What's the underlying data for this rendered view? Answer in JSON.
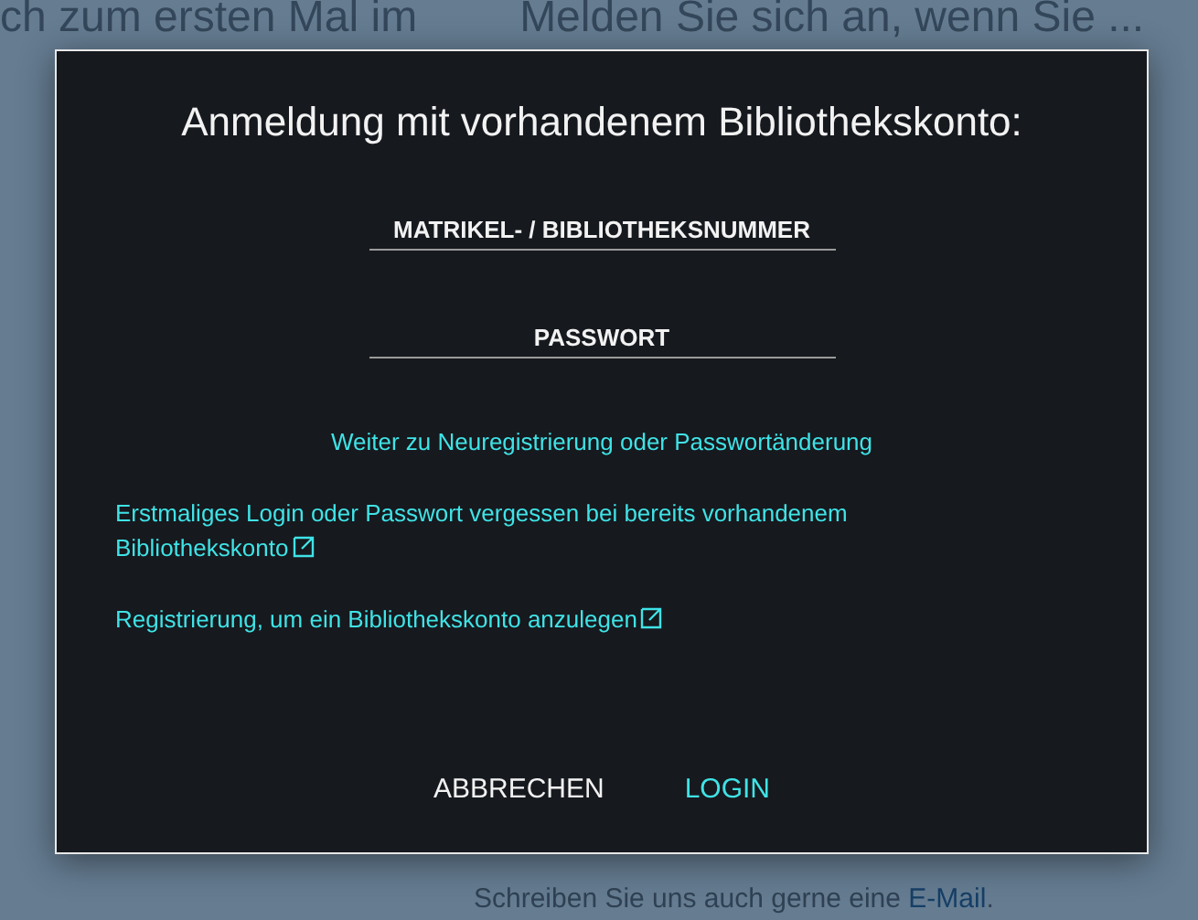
{
  "background": {
    "top_left_text": "ch zum ersten Mal im",
    "top_right_text": "Melden Sie sich an, wenn Sie ...",
    "bottom_text": "Schreiben Sie uns auch gerne eine",
    "bottom_link": "E-Mail",
    "bottom_end": "."
  },
  "dialog": {
    "title": "Anmeldung mit vorhandenem Bibliothekskonto:",
    "fields": [
      {
        "placeholder": "MATRIKEL- / BIBLIOTHEKSNUMMER"
      },
      {
        "placeholder": "PASSWORT"
      }
    ],
    "links": [
      {
        "label": "Weiter zu Neuregistrierung oder Passwortänderung",
        "kind": "centered",
        "external": false
      },
      {
        "label": "Erstmaliges Login oder Passwort vergessen bei bereits vorhandenem Bibliothekskonto",
        "kind": "left",
        "external": true
      },
      {
        "label": "Registrierung, um ein Bibliothekskonto anzulegen",
        "kind": "left",
        "external": true
      }
    ],
    "buttons": [
      {
        "label": "ABBRECHEN",
        "kind": "secondary"
      },
      {
        "label": "LOGIN",
        "kind": "primary"
      }
    ]
  }
}
